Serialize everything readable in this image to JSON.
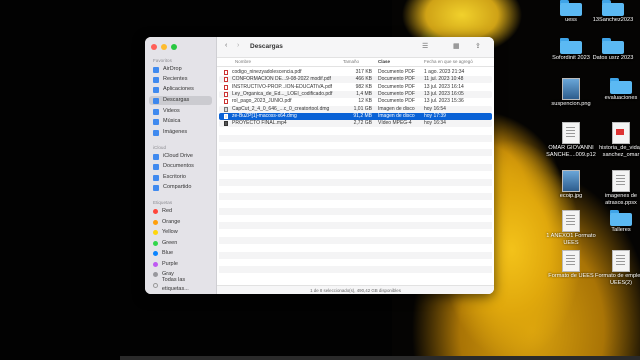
{
  "finder": {
    "title": "Descargas",
    "back": "‹",
    "forward": "›",
    "sidebar": {
      "favorites_header": "Favoritos",
      "favorites": [
        "AirDrop",
        "Recientes",
        "Aplicaciones",
        "Descargas",
        "Videos",
        "Música",
        "Imágenes"
      ],
      "icloud_header": "iCloud",
      "icloud": [
        "iCloud Drive",
        "Documentos",
        "Escritorio",
        "Compartido"
      ],
      "tags_header": "Etiquetas",
      "tags": [
        {
          "label": "Red",
          "color": "#ff453a"
        },
        {
          "label": "Orange",
          "color": "#ff9f0a"
        },
        {
          "label": "Yellow",
          "color": "#ffd60a"
        },
        {
          "label": "Green",
          "color": "#32d74b"
        },
        {
          "label": "Blue",
          "color": "#0a84ff"
        },
        {
          "label": "Purple",
          "color": "#bf5af2"
        },
        {
          "label": "Gray",
          "color": "#98989d"
        },
        {
          "label": "Todas las etiquetas...",
          "color": ""
        }
      ]
    },
    "columns": {
      "name": "Nombre",
      "size": "Tamaño",
      "kind": "Clase",
      "date": "Fecha en que se agregó"
    },
    "files": [
      {
        "name": "codigo_ninezyadolescencia.pdf",
        "size": "317 KB",
        "kind": "Documento PDF",
        "date": "1 ago. 2023 21:34",
        "type": "pdf"
      },
      {
        "name": "CONFORMACION DE...9-08-2022 modif.pdf",
        "size": "466 KB",
        "kind": "Documento PDF",
        "date": "11 jul. 2023 10:48",
        "type": "pdf"
      },
      {
        "name": "INSTRUCTIVO-PROP...ION-EDUCATIVA.pdf",
        "size": "982 KB",
        "kind": "Documento PDF",
        "date": "13 jul. 2023 16:14",
        "type": "pdf"
      },
      {
        "name": "Ley_Organica_de_Ed..._LOEI_codificado.pdf",
        "size": "1,4 MB",
        "kind": "Documento PDF",
        "date": "13 jul. 2023 16:05",
        "type": "pdf"
      },
      {
        "name": "rol_pago_2023_JUNIO.pdf",
        "size": "12 KB",
        "kind": "Documento PDF",
        "date": "13 jul. 2023 15:36",
        "type": "pdf"
      },
      {
        "name": "CapCut_2_4_0_646_...c_0_creatortool.dmg",
        "size": "1,01 GB",
        "kind": "Imagen de disco",
        "date": "hoy 16:54",
        "type": "app"
      },
      {
        "name": "ze-BuZP[1]-macoss-x64.dmg",
        "size": "91,2 MB",
        "kind": "Imagen de disco",
        "date": "hoy 17:39",
        "type": "dmg",
        "selected": true
      },
      {
        "name": "PROYECTO FINAL.mp4",
        "size": "2,72 GB",
        "kind": "Vídeo MPEG-4",
        "date": "hoy 16:34",
        "type": "mp4"
      }
    ],
    "status": "1 de 8 seleccionado(s), 490,42 GB disponibles"
  },
  "desktop": {
    "icons": [
      {
        "label": "uess",
        "kind": "folder"
      },
      {
        "label": "13Sanchez2023",
        "kind": "folder"
      },
      {
        "label": "Sofordinit 2023",
        "kind": "folder"
      },
      {
        "label": "Datos usrz 2023",
        "kind": "folder"
      },
      {
        "label": "suspencion.png",
        "kind": "img"
      },
      {
        "label": "evaluaciones",
        "kind": "folder"
      },
      {
        "label": "OMAR GIOVANNI SANCHE....009.p12",
        "kind": "doc"
      },
      {
        "label": "historia_de_vida_ sanchez_omar",
        "kind": "red"
      },
      {
        "label": "ecoip.jpg",
        "kind": "img"
      },
      {
        "label": "imagenes de atrasos.ppsx",
        "kind": "doc"
      },
      {
        "label": "1 ANEXO1 Formato UEES",
        "kind": "doc"
      },
      {
        "label": "Talleres",
        "kind": "folder"
      },
      {
        "label": "Formato de UEES",
        "kind": "doc"
      },
      {
        "label": "Formato de empleo - UEES(2)",
        "kind": "doc"
      }
    ]
  }
}
